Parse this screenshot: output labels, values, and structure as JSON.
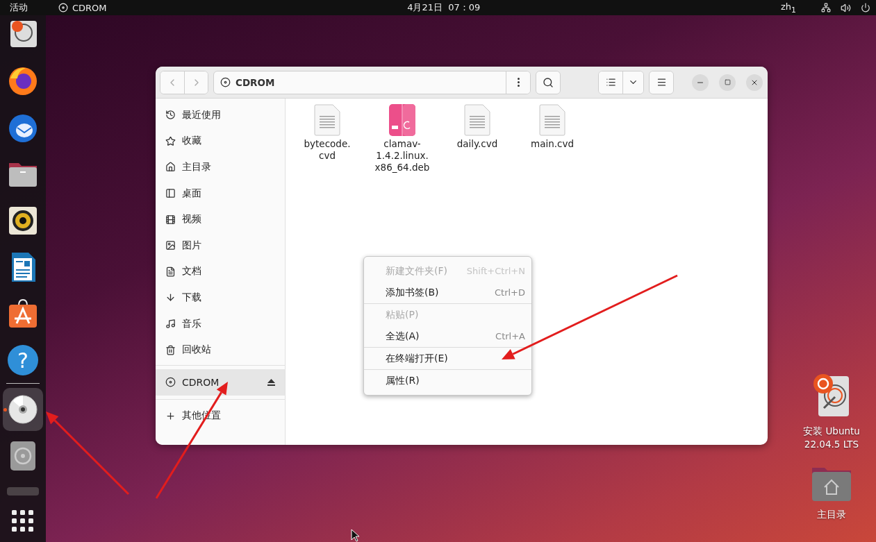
{
  "top_bar": {
    "activities": "活动",
    "app_name": "CDROM",
    "clock": "4月21日  07：09",
    "input_method": "zh$_{1}$"
  },
  "dock": {
    "items": [
      {
        "kind": "installer",
        "running": false,
        "selected": false
      },
      {
        "kind": "firefox",
        "running": false,
        "selected": false
      },
      {
        "kind": "thunderbird",
        "running": false,
        "selected": false
      },
      {
        "kind": "files",
        "running": false,
        "selected": false
      },
      {
        "kind": "rhythmbox",
        "running": false,
        "selected": false
      },
      {
        "kind": "writer",
        "running": false,
        "selected": false
      },
      {
        "kind": "appstore",
        "running": false,
        "selected": false
      },
      {
        "kind": "help",
        "glyph": "?",
        "running": false,
        "selected": false
      },
      {
        "kind": "separator"
      },
      {
        "kind": "cdrom",
        "running": true,
        "selected": true
      },
      {
        "kind": "disk",
        "running": false,
        "selected": false
      },
      {
        "kind": "stack",
        "running": false,
        "selected": false
      },
      {
        "kind": "apps",
        "running": false,
        "selected": false
      }
    ]
  },
  "window": {
    "path": "CDROM",
    "sidebar": {
      "items": [
        {
          "kind": "recent",
          "label": "最近使用",
          "selected": false
        },
        {
          "kind": "starred",
          "label": "收藏",
          "selected": false
        },
        {
          "kind": "home",
          "label": "主目录",
          "selected": false
        },
        {
          "kind": "desktop",
          "label": "桌面",
          "selected": false
        },
        {
          "kind": "videos",
          "label": "视频",
          "selected": false
        },
        {
          "kind": "pictures",
          "label": "图片",
          "selected": false
        },
        {
          "kind": "documents",
          "label": "文档",
          "selected": false
        },
        {
          "kind": "downloads",
          "label": "下载",
          "selected": false
        },
        {
          "kind": "music",
          "label": "音乐",
          "selected": false
        },
        {
          "kind": "trash",
          "label": "回收站",
          "selected": false
        }
      ],
      "devices": [
        {
          "kind": "disc",
          "label": "CDROM",
          "selected": true,
          "ejectable": true
        }
      ],
      "other": [
        {
          "kind": "plus",
          "label": "其他位置",
          "selected": false
        }
      ]
    },
    "files": [
      {
        "kind": "text",
        "lines": [
          "bytecode.",
          "cvd"
        ]
      },
      {
        "kind": "deb",
        "lines": [
          "clamav-",
          "1.4.2.linux.",
          "x86_64.deb"
        ]
      },
      {
        "kind": "text",
        "lines": [
          "daily.cvd"
        ]
      },
      {
        "kind": "text",
        "lines": [
          "main.cvd"
        ]
      }
    ]
  },
  "context_menu": {
    "sections": [
      [
        {
          "label": "新建文件夹(F)",
          "shortcut": "Shift+Ctrl+N",
          "disabled": true
        },
        {
          "label": "添加书签(B)",
          "shortcut": "Ctrl+D",
          "disabled": false
        }
      ],
      [
        {
          "label": "粘贴(P)",
          "disabled": true
        },
        {
          "label": "全选(A)",
          "shortcut": "Ctrl+A",
          "disabled": false
        }
      ],
      [
        {
          "label": "在终端打开(E)",
          "disabled": false
        }
      ],
      [
        {
          "label": "属性(R)",
          "disabled": false
        }
      ]
    ]
  },
  "desktop_icons": [
    {
      "kind": "installer",
      "lines": [
        "安装 Ubuntu",
        "22.04.5 LTS"
      ]
    },
    {
      "kind": "home",
      "lines": [
        "主目录"
      ]
    }
  ]
}
